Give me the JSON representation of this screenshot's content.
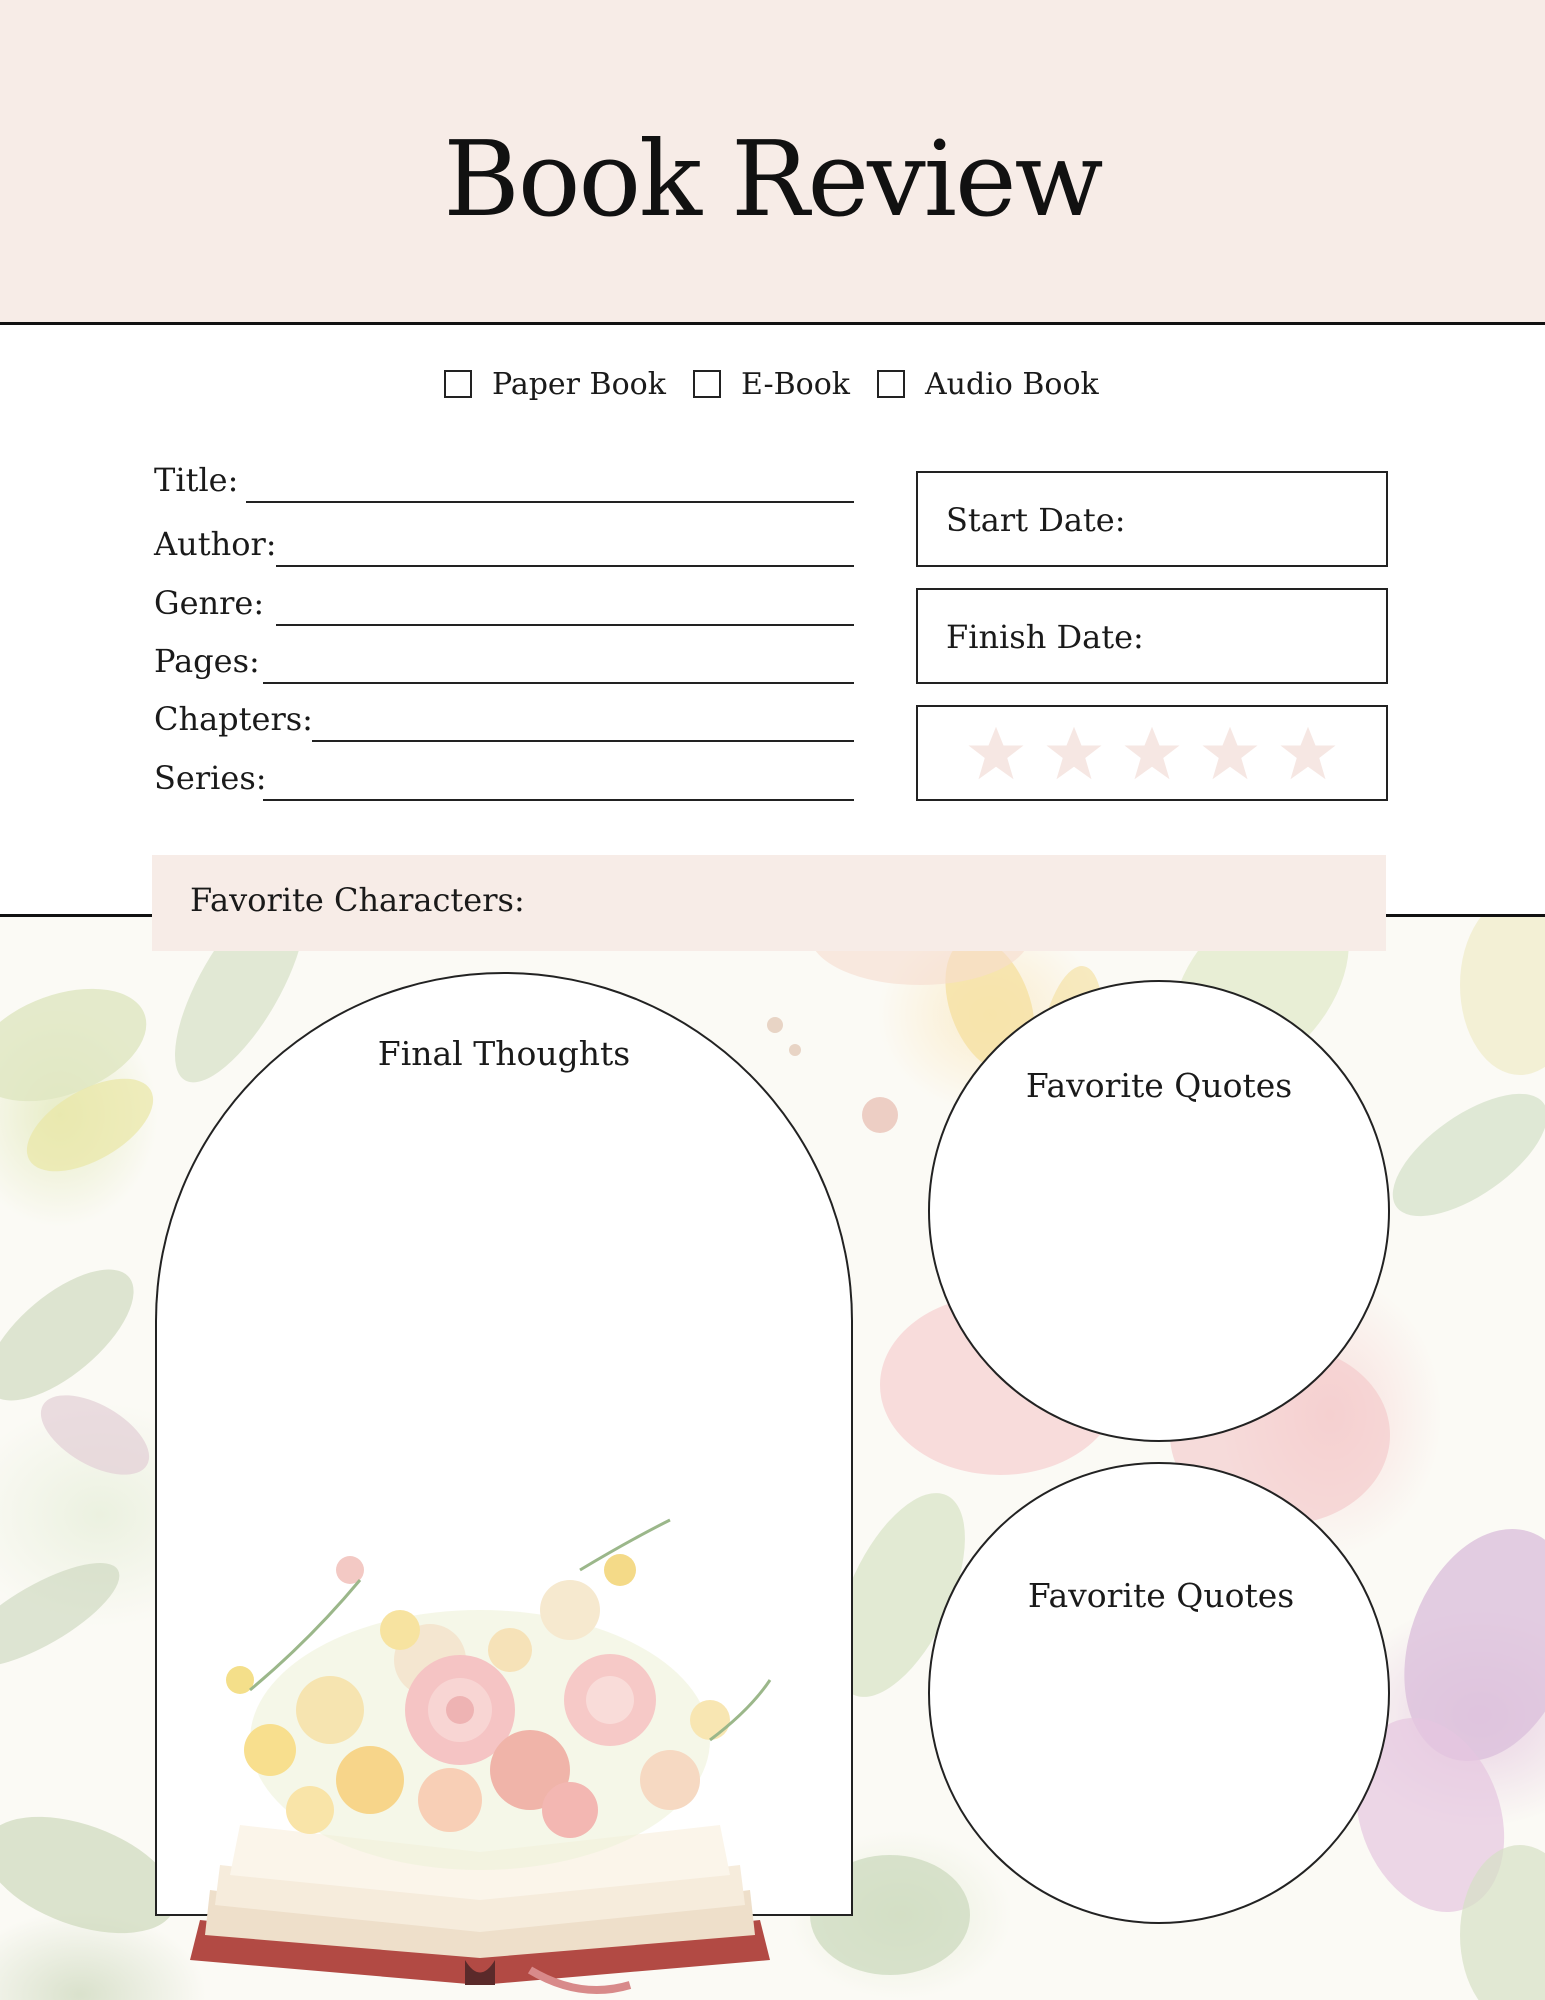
{
  "header": {
    "title": "Book Review"
  },
  "formats": [
    {
      "label": "Paper Book",
      "checked": false
    },
    {
      "label": "E-Book",
      "checked": false
    },
    {
      "label": "Audio Book",
      "checked": false
    }
  ],
  "fields": [
    {
      "label": "Title:",
      "value": ""
    },
    {
      "label": "Author:",
      "value": ""
    },
    {
      "label": "Genre:",
      "value": ""
    },
    {
      "label": "Pages:",
      "value": ""
    },
    {
      "label": "Chapters:",
      "value": ""
    },
    {
      "label": "Series:",
      "value": ""
    }
  ],
  "dates": {
    "start_label": "Start Date:",
    "finish_label": "Finish Date:"
  },
  "rating": {
    "stars_total": 5,
    "stars_filled": 0,
    "star_color": "#f6e7e3"
  },
  "favorite_characters": {
    "label": "Favorite Characters:"
  },
  "final_thoughts": {
    "label": "Final Thoughts"
  },
  "quotes": [
    {
      "label": "Favorite Quotes"
    },
    {
      "label": "Favorite Quotes"
    }
  ],
  "colors": {
    "accent": "#f7ece7",
    "line": "#111111"
  }
}
